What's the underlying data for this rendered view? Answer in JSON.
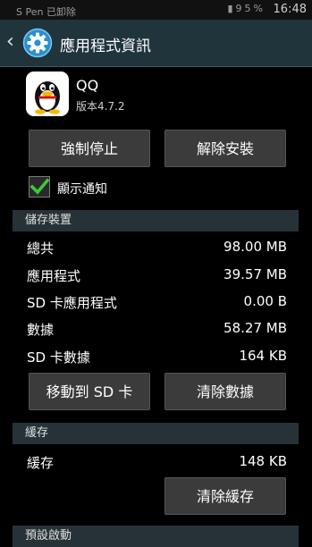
{
  "status_bar": {
    "notification": "S Pen 已卸除",
    "battery": "95%",
    "time": "16:48"
  },
  "action_bar": {
    "title": "應用程式資訊",
    "icon": "gear-icon"
  },
  "app": {
    "name": "QQ",
    "version": "版本4.7.2",
    "icon": "qq-penguin-icon"
  },
  "buttons": {
    "force_stop": "強制停止",
    "uninstall": "解除安裝",
    "move_to_sd": "移動到 SD 卡",
    "clear_data": "清除數據",
    "clear_cache": "清除緩存"
  },
  "notifications": {
    "label": "顯示通知",
    "checked": true
  },
  "storage": {
    "header": "儲存裝置",
    "rows": [
      {
        "label": "總共",
        "value": "98.00 MB"
      },
      {
        "label": "應用程式",
        "value": "39.57 MB"
      },
      {
        "label": "SD 卡應用程式",
        "value": "0.00 B"
      },
      {
        "label": "數據",
        "value": "58.27 MB"
      },
      {
        "label": "SD 卡數據",
        "value": "164 KB"
      }
    ]
  },
  "cache": {
    "header": "緩存",
    "row": {
      "label": "緩存",
      "value": "148 KB"
    }
  },
  "next_section": {
    "header": "預設啟動"
  },
  "colors": {
    "action_bar": "#20343b",
    "section_header": "#263238",
    "button": "#3b3b3b",
    "check": "#3cc93c"
  }
}
